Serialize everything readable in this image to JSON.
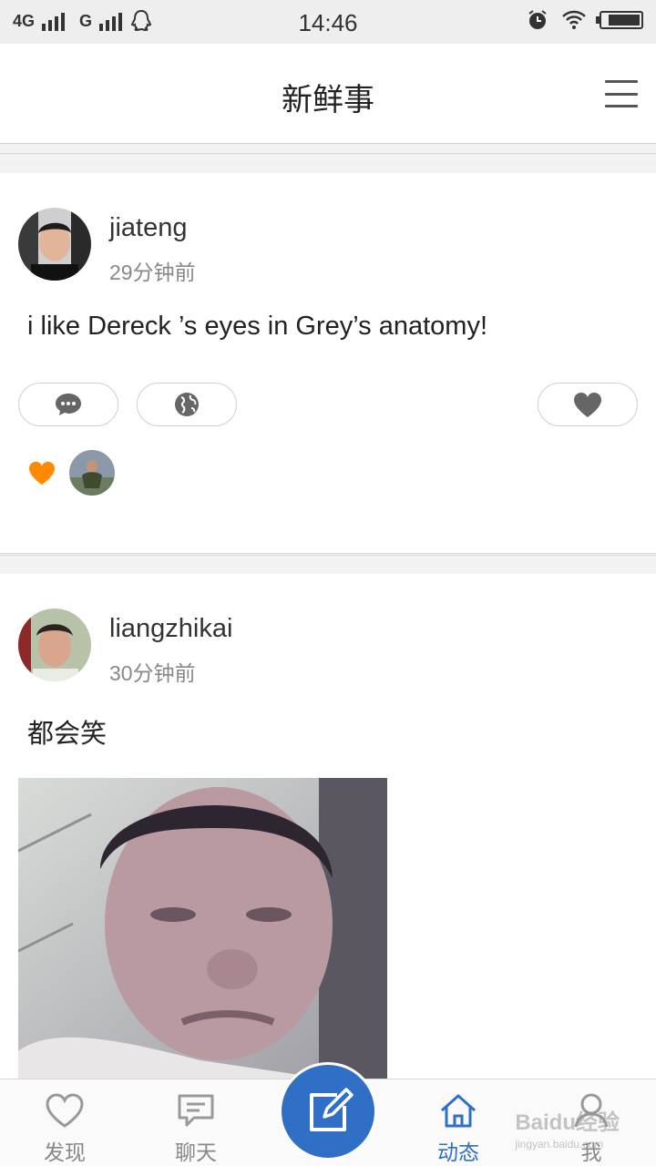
{
  "status_bar": {
    "network1": "4G",
    "network2": "G",
    "time": "14:46",
    "battery_level": 0.85
  },
  "header": {
    "title": "新鲜事"
  },
  "posts": [
    {
      "username": "jiateng",
      "time_ago": "29分钟前",
      "text": "i like Dereck ’s eyes in Grey’s anatomy!"
    },
    {
      "username": "liangzhikai",
      "time_ago": "30分钟前",
      "text": "都会笑"
    }
  ],
  "tabbar": {
    "tabs": [
      {
        "label": "发现",
        "icon": "heart-outline-icon"
      },
      {
        "label": "聊天",
        "icon": "chat-bubble-icon"
      },
      {
        "label": "动态",
        "icon": "home-icon",
        "active": true
      },
      {
        "label": "我",
        "icon": "person-icon"
      }
    ],
    "compose_icon": "compose-icon"
  },
  "watermark": {
    "brand": "Baidu经验",
    "url": "jingyan.baidu.com"
  },
  "colors": {
    "accent": "#2f6fc6",
    "like": "#ff8a00"
  }
}
